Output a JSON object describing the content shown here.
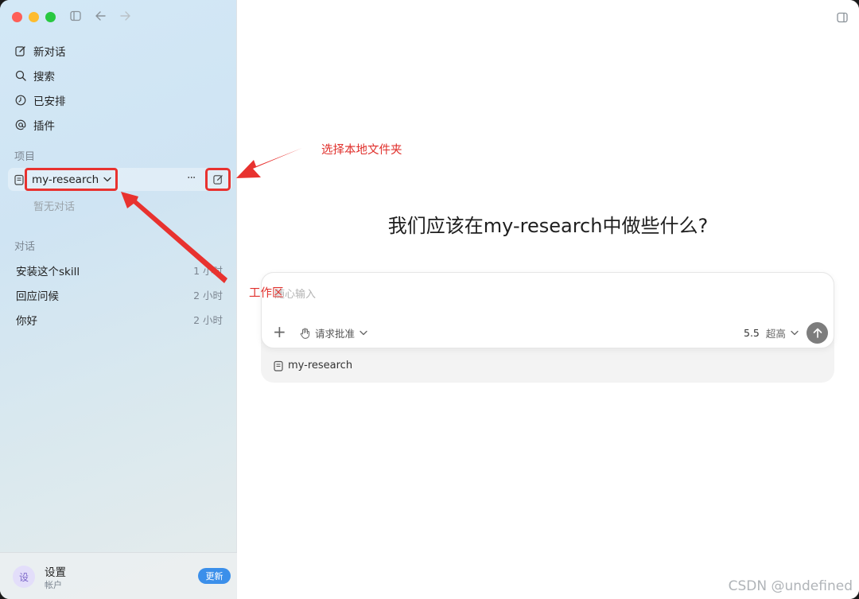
{
  "sidebar": {
    "nav": [
      {
        "label": "新对话",
        "icon": "edit-icon"
      },
      {
        "label": "搜索",
        "icon": "search-icon"
      },
      {
        "label": "已安排",
        "icon": "clock-icon"
      },
      {
        "label": "插件",
        "icon": "at-icon"
      }
    ],
    "projects_label": "项目",
    "project_name": "my-research",
    "project_more": "···",
    "no_conversations": "暂无对话",
    "conversations_label": "对话",
    "conversations": [
      {
        "title": "安装这个skill",
        "time": "1 小时"
      },
      {
        "title": "回应问候",
        "time": "2 小时"
      },
      {
        "title": "你好",
        "time": "2 小时"
      }
    ],
    "footer": {
      "avatar": "设",
      "title": "设置",
      "subtitle": "帐户",
      "update_label": "更新"
    }
  },
  "main": {
    "headline": "我们应该在my-research中做些什么?",
    "composer": {
      "placeholder": "随心输入",
      "plus": "+",
      "approval_label": "请求批准",
      "model_version": "5.5",
      "model_level": "超高"
    },
    "workspace_label": "my-research"
  },
  "annotations": {
    "folder_note": "选择本地文件夹",
    "workspace_note": "工作区"
  },
  "watermark": "CSDN @undefined",
  "colors": {
    "annotation_red": "#e0302c",
    "update_blue": "#3b8fea"
  }
}
